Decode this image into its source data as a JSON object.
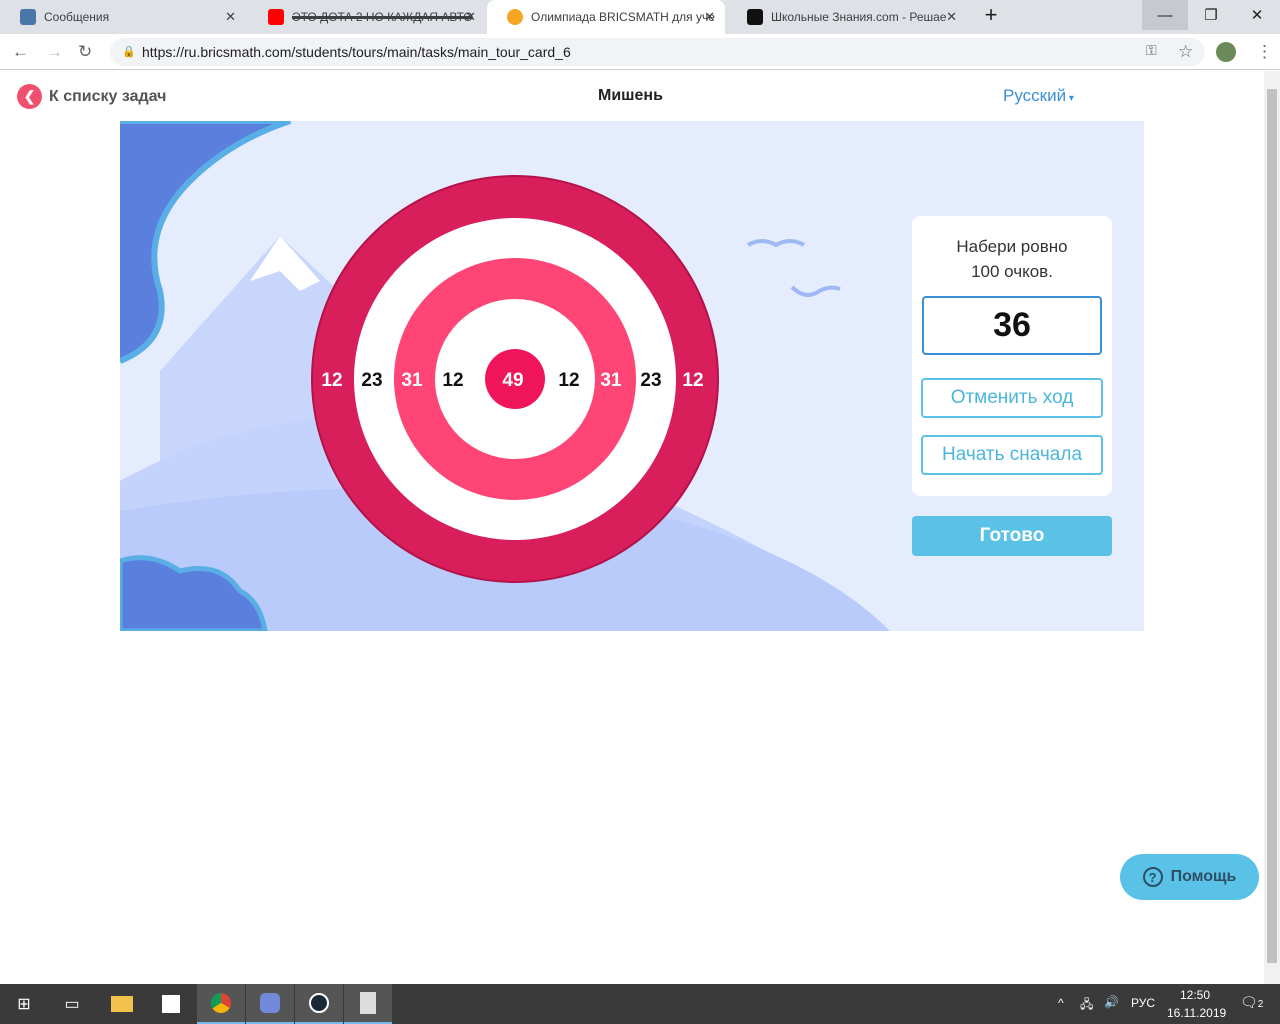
{
  "browser": {
    "tabs": [
      {
        "label": "Сообщения",
        "color": "#4a76a8"
      },
      {
        "label": "ЭТО ДОТА 2 НО КАЖДАЯ АВТО",
        "color": "#ff0000"
      },
      {
        "label": "Олимпиада BRICSMATH для уче",
        "color": "#f5a623"
      },
      {
        "label": "Школьные Знания.com - Решае",
        "color": "#111"
      }
    ],
    "url": "https://ru.bricsmath.com/students/tours/main/tasks/main_tour_card_6"
  },
  "header": {
    "back_label": "К списку задач",
    "title": "Мишень",
    "language": "Русский"
  },
  "target": {
    "labels": [
      "12",
      "23",
      "31",
      "12",
      "49",
      "12",
      "31",
      "23",
      "12"
    ],
    "colors": {
      "outer": "#d81e5b",
      "middle": "#ff4575",
      "center": "#f0145a"
    }
  },
  "panel": {
    "task_line1": "Набери ровно",
    "task_line2": "100 очков.",
    "score": "36",
    "undo_label": "Отменить ход",
    "restart_label": "Начать сначала",
    "done_label": "Готово"
  },
  "help_label": "Помощь",
  "taskbar": {
    "lang": "РУС",
    "time": "12:50",
    "date": "16.11.2019",
    "notifications": "2"
  }
}
